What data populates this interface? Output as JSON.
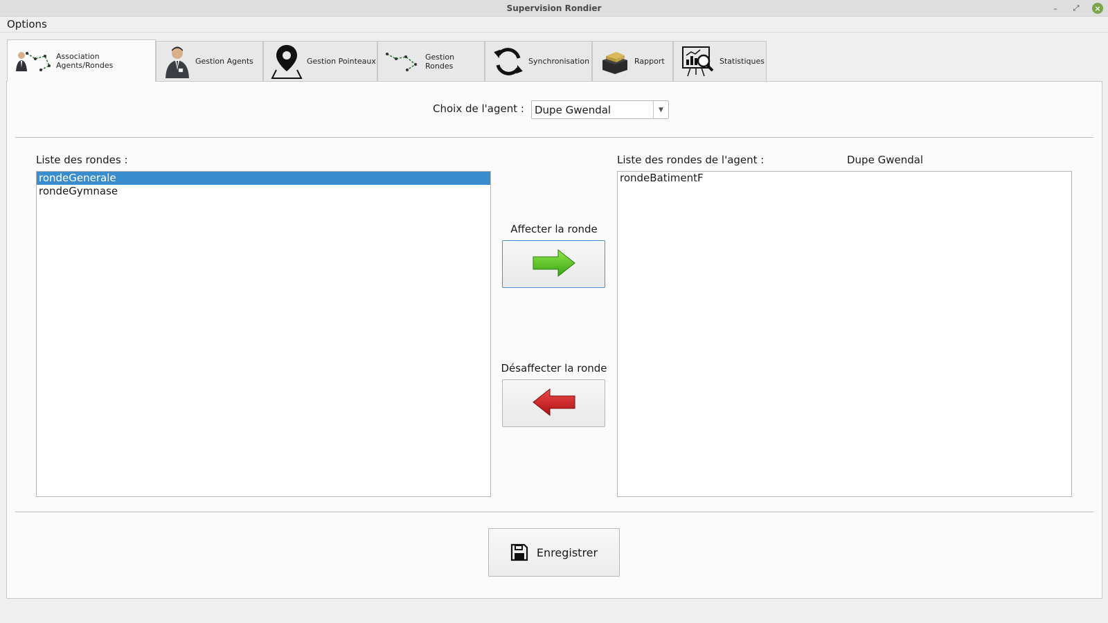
{
  "window": {
    "title": "Supervision Rondier"
  },
  "menu": {
    "options": "Options"
  },
  "tabs": [
    {
      "label": "Association Agents/Rondes",
      "icon": "agent-route-icon"
    },
    {
      "label": "Gestion Agents",
      "icon": "agent-icon"
    },
    {
      "label": "Gestion Pointeaux",
      "icon": "map-pin-icon"
    },
    {
      "label": "Gestion Rondes",
      "icon": "route-icon"
    },
    {
      "label": "Synchronisation",
      "icon": "sync-icon"
    },
    {
      "label": "Rapport",
      "icon": "report-box-icon"
    },
    {
      "label": "Statistiques",
      "icon": "statistics-icon"
    }
  ],
  "agent_choice": {
    "label": "Choix de l'agent :",
    "selected": "Dupe Gwendal"
  },
  "rounds_list": {
    "title": "Liste des rondes :",
    "items": [
      "rondeGenerale",
      "rondeGymnase"
    ],
    "selected": "rondeGenerale"
  },
  "agent_rounds": {
    "title": "Liste des rondes de l'agent :",
    "agent_name": "Dupe Gwendal",
    "items": [
      "rondeBatimentF"
    ]
  },
  "assign": {
    "label": "Affecter la ronde",
    "arrow_color": "#5cc622"
  },
  "unassign": {
    "label": "Désaffecter la ronde",
    "arrow_color": "#d41d1d"
  },
  "save": {
    "label": "Enregistrer"
  },
  "colors": {
    "selection": "#3a8dcc",
    "close_button": "#7aa548"
  }
}
